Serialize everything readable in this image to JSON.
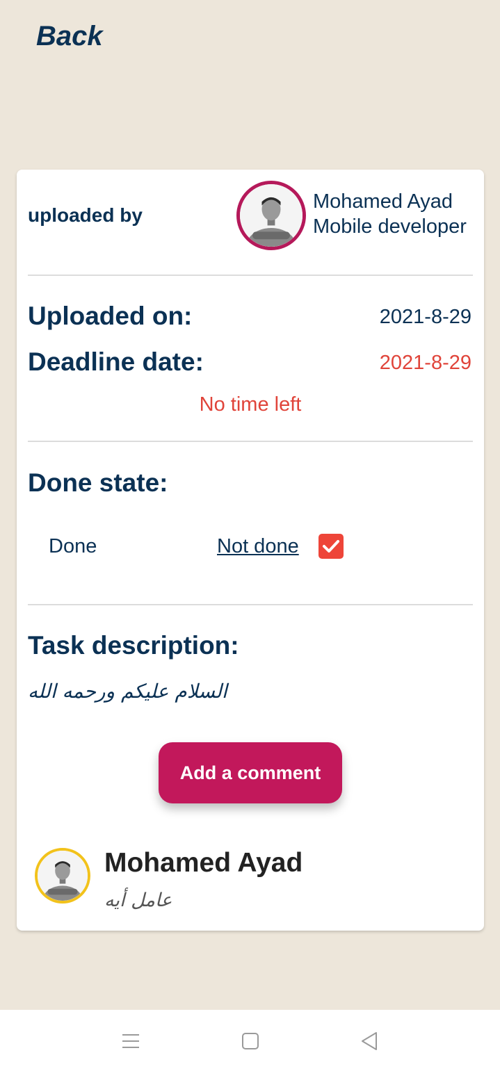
{
  "header": {
    "back_label": "Back"
  },
  "uploader": {
    "label": "uploaded by",
    "name": "Mohamed Ayad",
    "role": "Mobile developer",
    "avatar_icon": "person-avatar-icon",
    "ring_color": "#b5195a"
  },
  "dates": {
    "uploaded_label": "Uploaded on:",
    "uploaded_value": "2021-8-29",
    "deadline_label": "Deadline date:",
    "deadline_value": "2021-8-29",
    "time_left": "No time left"
  },
  "done_state": {
    "label": "Done state:",
    "options": [
      "Done",
      "Not done"
    ],
    "selected": "Not done",
    "checked": true,
    "check_color": "#ee4539"
  },
  "description": {
    "label": "Task description:",
    "text": "السلام عليكم ورحمه الله"
  },
  "comment_button": {
    "label": "Add a comment",
    "color": "#c2185b"
  },
  "comment": {
    "author": "Mohamed Ayad",
    "text": "عامل أيه",
    "ring_color": "#f2c21b"
  },
  "nav_bar": {
    "items": [
      "menu-icon",
      "home-square-icon",
      "back-triangle-icon"
    ]
  },
  "colors": {
    "background": "#ede6da",
    "primary_text": "#0b3154",
    "alert": "#e0443a"
  }
}
